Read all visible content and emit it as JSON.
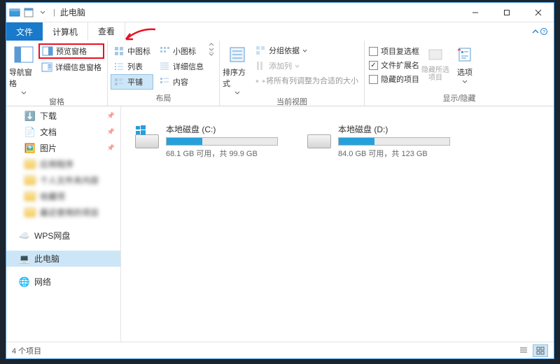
{
  "title": "此电脑",
  "tabs": {
    "file": "文件",
    "computer": "计算机",
    "view": "查看"
  },
  "ribbon": {
    "panes": {
      "label": "窗格",
      "nav": "导航窗格",
      "preview": "预览窗格",
      "details": "详细信息窗格"
    },
    "layout": {
      "label": "布局",
      "medium_icons": "中图标",
      "small_icons": "小图标",
      "list": "列表",
      "details": "详细信息",
      "tiles": "平铺",
      "content": "内容"
    },
    "current_view": {
      "label": "当前视图",
      "sort": "排序方式",
      "group_by": "分组依据",
      "add_columns": "添加列",
      "fit_columns": "将所有列调整为合适的大小"
    },
    "show_hide": {
      "label": "显示/隐藏",
      "item_checkboxes": "项目复选框",
      "file_ext": "文件扩展名",
      "hidden_items": "隐藏的项目",
      "hide_selected": "隐藏所选项目",
      "options": "选项"
    }
  },
  "sidebar": {
    "downloads": "下载",
    "documents": "文档",
    "pictures": "图片",
    "blur1": "应用程序",
    "blur2": "个人文件夹内容",
    "blur3": "收藏项",
    "blur4": "最近使用的项目",
    "wps": "WPS网盘",
    "this_pc": "此电脑",
    "network": "网络"
  },
  "drives": [
    {
      "name": "本地磁盘 (C:)",
      "free": "68.1 GB 可用，共 99.9 GB",
      "fill_pct": 32,
      "is_system": true
    },
    {
      "name": "本地磁盘 (D:)",
      "free": "84.0 GB 可用，共 123 GB",
      "fill_pct": 32,
      "is_system": false
    }
  ],
  "status": {
    "items": "4 个项目"
  }
}
